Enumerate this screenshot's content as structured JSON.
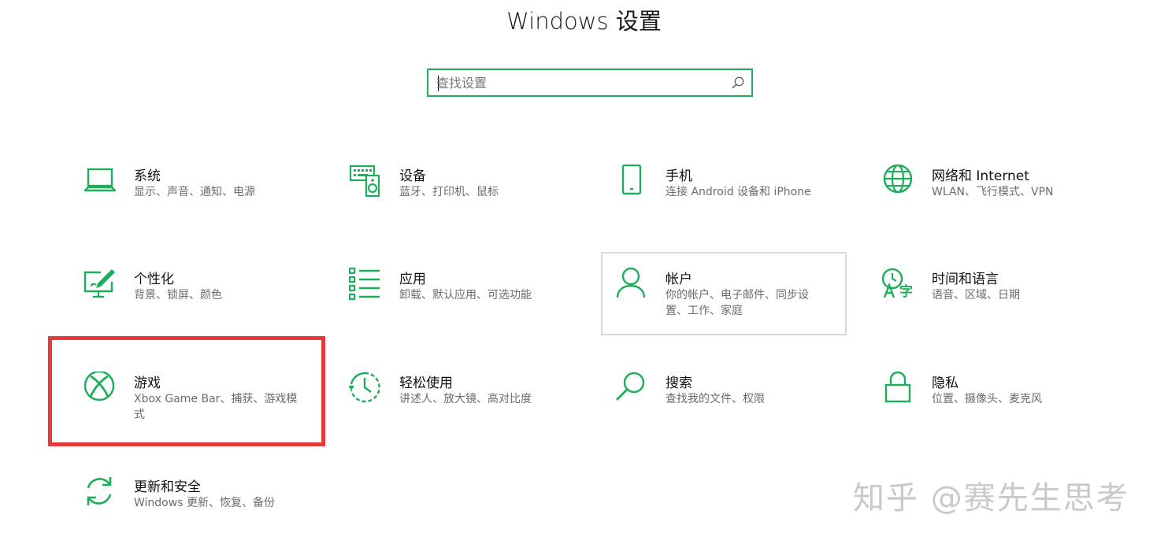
{
  "window": {
    "title": "Windows 设置"
  },
  "search": {
    "placeholder": "查找设置",
    "value": ""
  },
  "accent_color": "#1dae5a",
  "tiles": [
    {
      "name": "系统",
      "desc": "显示、声音、通知、电源",
      "icon": "laptop-icon"
    },
    {
      "name": "设备",
      "desc": "蓝牙、打印机、鼠标",
      "icon": "keyboard-speaker-icon"
    },
    {
      "name": "手机",
      "desc": "连接 Android 设备和 iPhone",
      "icon": "phone-icon"
    },
    {
      "name": "网络和 Internet",
      "desc": "WLAN、飞行模式、VPN",
      "icon": "globe-icon"
    },
    {
      "name": "个性化",
      "desc": "背景、锁屏、颜色",
      "icon": "paint-monitor-icon"
    },
    {
      "name": "应用",
      "desc": "卸载、默认应用、可选功能",
      "icon": "apps-list-icon"
    },
    {
      "name": "帐户",
      "desc": "你的帐户、电子邮件、同步设置、工作、家庭",
      "icon": "person-icon"
    },
    {
      "name": "时间和语言",
      "desc": "语音、区域、日期",
      "icon": "time-language-icon"
    },
    {
      "name": "游戏",
      "desc": "Xbox Game Bar、捕获、游戏模式",
      "icon": "xbox-icon"
    },
    {
      "name": "轻松使用",
      "desc": "讲述人、放大镜、高对比度",
      "icon": "ease-of-access-icon"
    },
    {
      "name": "搜索",
      "desc": "查找我的文件、权限",
      "icon": "magnifier-icon"
    },
    {
      "name": "隐私",
      "desc": "位置、摄像头、麦克风",
      "icon": "lock-icon"
    },
    {
      "name": "更新和安全",
      "desc": "Windows 更新、恢复、备份",
      "icon": "sync-icon"
    }
  ],
  "watermark": "知乎 @赛先生思考"
}
